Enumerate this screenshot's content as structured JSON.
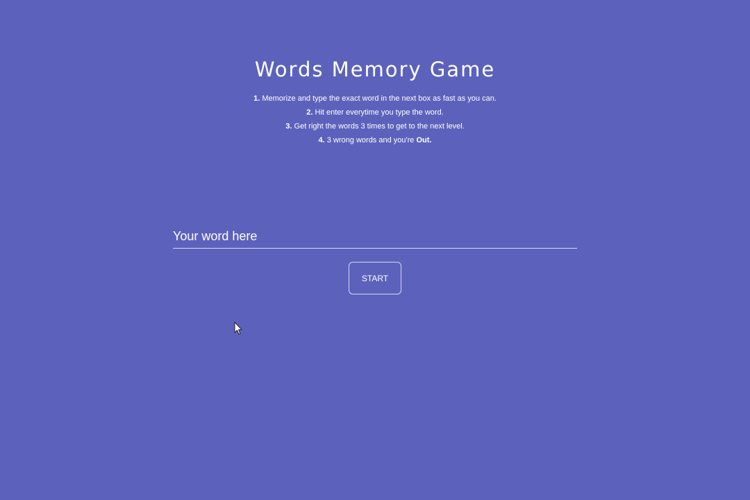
{
  "page": {
    "title": "Words Memory Game",
    "background_color": "#5c62bc",
    "text_color": "#ffffff"
  },
  "instructions": [
    {
      "num": "1.",
      "text": " Memorize and type the exact word in the next box as fast as you can."
    },
    {
      "num": "2.",
      "text": " Hit enter everytime you type the word."
    },
    {
      "num": "3.",
      "text": " Get right the words 3 times to get to the next level."
    },
    {
      "num": "4.",
      "text": " 3 wrong words and you're ",
      "emphasis": "Out."
    }
  ],
  "word_input": {
    "value": "",
    "placeholder": "Your word here"
  },
  "start_button": {
    "label": "START"
  },
  "cursor": {
    "icon": "mouse-pointer-icon"
  }
}
